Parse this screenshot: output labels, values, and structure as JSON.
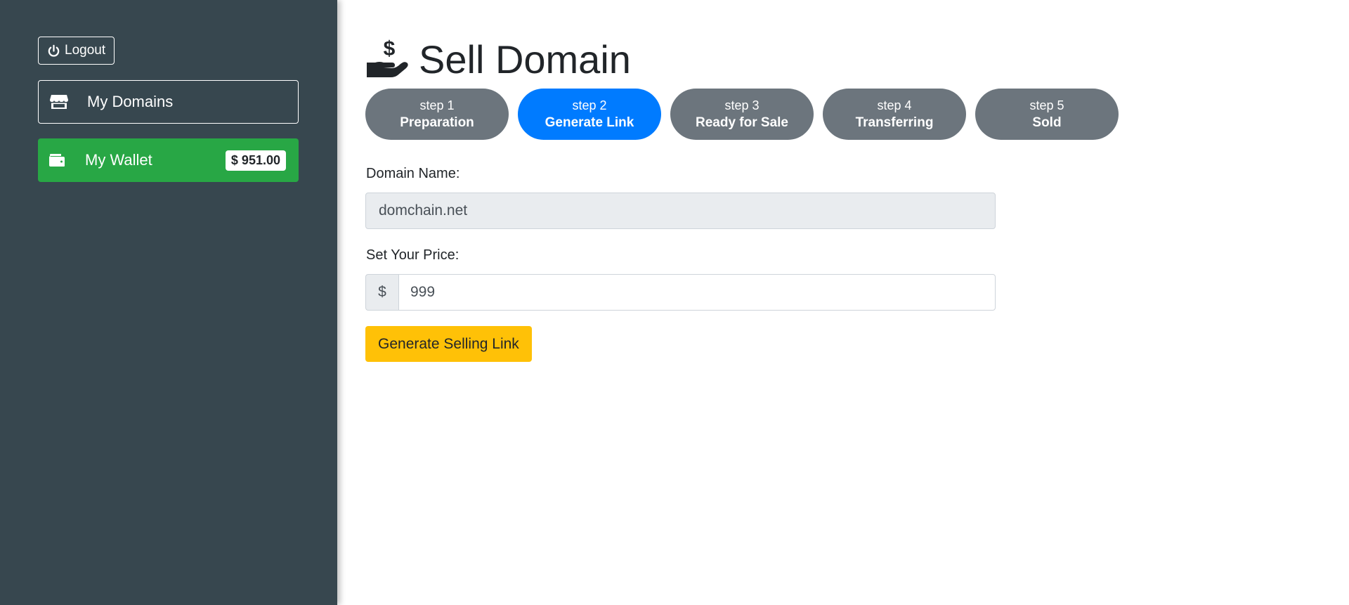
{
  "sidebar": {
    "logout_label": "Logout",
    "nav": {
      "domains_label": "My Domains",
      "wallet_label": "My Wallet",
      "wallet_balance": "$ 951.00"
    }
  },
  "main": {
    "title": "Sell Domain",
    "steps": [
      {
        "num": "step 1",
        "name": "Preparation",
        "active": false
      },
      {
        "num": "step 2",
        "name": "Generate Link",
        "active": true
      },
      {
        "num": "step 3",
        "name": "Ready for Sale",
        "active": false
      },
      {
        "num": "step 4",
        "name": "Transferring",
        "active": false
      },
      {
        "num": "step 5",
        "name": "Sold",
        "active": false
      }
    ],
    "form": {
      "domain_label": "Domain Name:",
      "domain_value": "domchain.net",
      "price_label": "Set Your Price:",
      "currency_prefix": "$",
      "price_value": "999",
      "generate_label": "Generate Selling Link"
    }
  },
  "colors": {
    "sidebar_bg": "#37474f",
    "wallet_green": "#28a745",
    "active_step": "#007bff",
    "inactive_step": "#6c757d",
    "generate_button": "#ffc107"
  },
  "icons": {
    "logout": "power-icon",
    "domains": "store-icon",
    "wallet": "wallet-icon",
    "title": "hand-holding-dollar-icon"
  }
}
